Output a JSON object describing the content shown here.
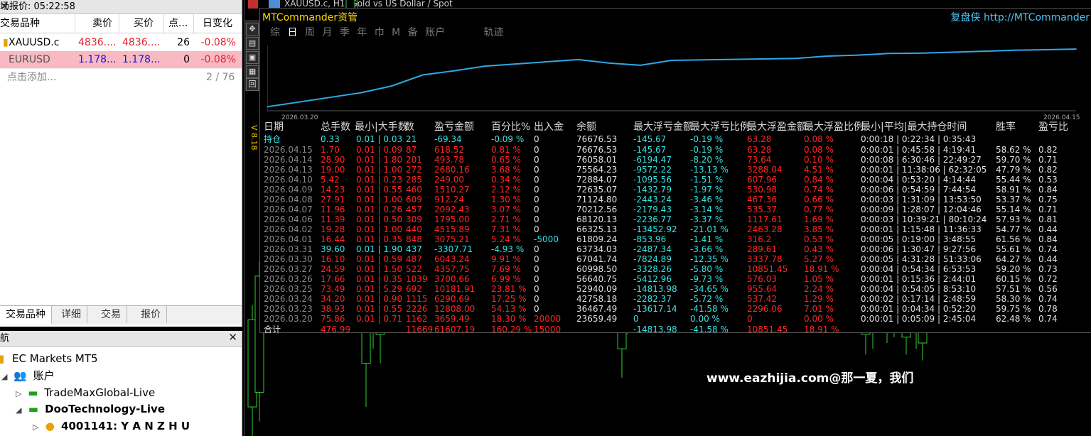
{
  "market_watch": {
    "title": "场报价: 05:22:58",
    "columns": [
      "交易品种",
      "卖价",
      "买价",
      "点...",
      "日变化"
    ],
    "rows": [
      {
        "symbol": "XAUUSD.c",
        "bid": "4836....",
        "ask": "4836....",
        "spread": "26",
        "change": "-0.08%"
      },
      {
        "symbol": "EURUSD",
        "bid": "1.178...",
        "ask": "1.178...",
        "spread": "0",
        "change": "-0.08%"
      }
    ],
    "add_label": "点击添加...",
    "count": "2 / 76",
    "tabs": [
      "交易品种",
      "详细",
      "交易",
      "报价"
    ]
  },
  "navigator": {
    "title": "航",
    "items": [
      "EC Markets MT5",
      "账户",
      "TradeMaxGlobal-Live",
      "DooTechnology-Live",
      "4001141: Y A N Z H U"
    ]
  },
  "chart": {
    "title": "XAUUSD.c, H1:  Gold vs US Dollar / Spot",
    "version": "V 8.18",
    "watermark": "www.eazhijia.com@那一夏，我们",
    "candle_axis_range": [
      0,
      150
    ]
  },
  "overlay": {
    "title": "MTCommander资管",
    "brand": "复盘侠 http://MTCommander",
    "tabs": [
      "综",
      "日",
      "周",
      "月",
      "季",
      "年",
      "巾",
      "M",
      "备",
      "账户",
      "轨迹"
    ],
    "selected_tab": "日",
    "colors": {
      "line": "#2fa8e6",
      "negative": "#ff2525",
      "positive": "#35e3e3"
    }
  },
  "chart_data": {
    "type": "line",
    "x_start_label": "2026.03.20",
    "x_end_label": "2026.04.15",
    "points": [
      {
        "x": "2026.03.20",
        "y": 23659.49
      },
      {
        "x": "2026.03.23",
        "y": 36467.49
      },
      {
        "x": "2026.03.24",
        "y": 42758.18
      },
      {
        "x": "2026.03.25",
        "y": 52940.09
      },
      {
        "x": "2026.03.26",
        "y": 56640.75
      },
      {
        "x": "2026.03.27",
        "y": 60998.5
      },
      {
        "x": "2026.03.30",
        "y": 67041.74
      },
      {
        "x": "2026.03.31",
        "y": 63734.03
      },
      {
        "x": "2026.04.01",
        "y": 61809.24
      },
      {
        "x": "2026.04.02",
        "y": 66325.13
      },
      {
        "x": "2026.04.06",
        "y": 68120.13
      },
      {
        "x": "2026.04.07",
        "y": 70212.56
      },
      {
        "x": "2026.04.08",
        "y": 71124.8
      },
      {
        "x": "2026.04.09",
        "y": 72635.07
      },
      {
        "x": "2026.04.10",
        "y": 72884.07
      },
      {
        "x": "2026.04.13",
        "y": 75564.23
      },
      {
        "x": "2026.04.14",
        "y": 76058.01
      },
      {
        "x": "2026.04.15",
        "y": 76676.53
      }
    ],
    "ylim": [
      20000,
      80000
    ]
  },
  "table": {
    "headers": [
      "日期",
      "总手数",
      "最小|大手数",
      "数",
      "盈亏金额",
      "百分比%",
      "出入金",
      "余额",
      "最大浮亏金额",
      "最大浮亏比例",
      "最大浮盈金额",
      "最大浮盈比例",
      "最小|平均|最大持仓时间",
      "胜率",
      "盈亏比"
    ],
    "holding": {
      "date": "持仓",
      "lots": "0.33",
      "minmax": "0.01 | 0.03",
      "count": "21",
      "pl": "-69.34",
      "pct": "-0.09 %",
      "inout": "0",
      "balance": "76676.53",
      "maxfl": "-145.67",
      "maxflp": "-0.19 %",
      "maxfp": "63.28",
      "maxfpp": "0.08 %",
      "hold": "0:00:18 | 0:22:34 | 0:35:43",
      "win": "",
      "rr": ""
    },
    "rows": [
      {
        "date": "2026.04.15",
        "lots": "1.70",
        "minmax": "0.01 | 0.09",
        "count": "87",
        "pl": "618.52",
        "pct": "0.81 %",
        "inout": "0",
        "balance": "76676.53",
        "maxfl": "-145.67",
        "maxflp": "-0.19 %",
        "maxfp": "63.28",
        "maxfpp": "0.08 %",
        "hold": "0:00:01 | 0:45:58 | 4:19:41",
        "win": "58.62 %",
        "rr": "0.82"
      },
      {
        "date": "2026.04.14",
        "lots": "28.90",
        "minmax": "0.01 | 1.80",
        "count": "201",
        "pl": "493.78",
        "pct": "0.65 %",
        "inout": "0",
        "balance": "76058.01",
        "maxfl": "-6194.47",
        "maxflp": "-8.20 %",
        "maxfp": "73.64",
        "maxfpp": "0.10 %",
        "hold": "0:00:08 | 6:30:46 | 22:49:27",
        "win": "59.70 %",
        "rr": "0.71"
      },
      {
        "date": "2026.04.13",
        "lots": "19.00",
        "minmax": "0.01 | 1.00",
        "count": "272",
        "pl": "2680.16",
        "pct": "3.68 %",
        "inout": "0",
        "balance": "75564.23",
        "maxfl": "-9572.22",
        "maxflp": "-13.13 %",
        "maxfp": "3288.04",
        "maxfpp": "4.51 %",
        "hold": "0:00:01 | 11:38:06 | 62:32:05",
        "win": "47.79 %",
        "rr": "0.82"
      },
      {
        "date": "2026.04.10",
        "lots": "5.42",
        "minmax": "0.01 | 0.23",
        "count": "285",
        "pl": "249.00",
        "pct": "0.34 %",
        "inout": "0",
        "balance": "72884.07",
        "maxfl": "-1095.56",
        "maxflp": "-1.51 %",
        "maxfp": "607.96",
        "maxfpp": "0.84 %",
        "hold": "0:00:04 | 0:53:20 | 4:14:44",
        "win": "55.44 %",
        "rr": "0.53"
      },
      {
        "date": "2026.04.09",
        "lots": "14.23",
        "minmax": "0.01 | 0.55",
        "count": "460",
        "pl": "1510.27",
        "pct": "2.12 %",
        "inout": "0",
        "balance": "72635.07",
        "maxfl": "-1432.79",
        "maxflp": "-1.97 %",
        "maxfp": "530.98",
        "maxfpp": "0.74 %",
        "hold": "0:00:06 | 0:54:59 | 7:44:54",
        "win": "58.91 %",
        "rr": "0.84"
      },
      {
        "date": "2026.04.08",
        "lots": "27.91",
        "minmax": "0.01 | 1.00",
        "count": "609",
        "pl": "912.24",
        "pct": "1.30 %",
        "inout": "0",
        "balance": "71124.80",
        "maxfl": "-2443.24",
        "maxflp": "-3.46 %",
        "maxfp": "467.36",
        "maxfpp": "0.66 %",
        "hold": "0:00:03 | 1:31:09 | 13:53:50",
        "win": "53.37 %",
        "rr": "0.75"
      },
      {
        "date": "2026.04.07",
        "lots": "11.96",
        "minmax": "0.01 | 0.26",
        "count": "457",
        "pl": "2092.43",
        "pct": "3.07 %",
        "inout": "0",
        "balance": "70212.56",
        "maxfl": "-2179.43",
        "maxflp": "-3.14 %",
        "maxfp": "535.37",
        "maxfpp": "0.77 %",
        "hold": "0:00:09 | 1:28:07 | 12:04:46",
        "win": "55.14 %",
        "rr": "0.71"
      },
      {
        "date": "2026.04.06",
        "lots": "11.39",
        "minmax": "0.01 | 0.50",
        "count": "309",
        "pl": "1795.00",
        "pct": "2.71 %",
        "inout": "0",
        "balance": "68120.13",
        "maxfl": "-2236.77",
        "maxflp": "-3.37 %",
        "maxfp": "1117.61",
        "maxfpp": "1.69 %",
        "hold": "0:00:03 | 10:39:21 | 80:10:24",
        "win": "57.93 %",
        "rr": "0.81"
      },
      {
        "date": "2026.04.02",
        "lots": "19.28",
        "minmax": "0.01 | 1.00",
        "count": "440",
        "pl": "4515.89",
        "pct": "7.31 %",
        "inout": "0",
        "balance": "66325.13",
        "maxfl": "-13452.92",
        "maxflp": "-21.01 %",
        "maxfp": "2463.28",
        "maxfpp": "3.85 %",
        "hold": "0:00:01 | 1:15:48 | 11:36:33",
        "win": "54.77 %",
        "rr": "0.44"
      },
      {
        "date": "2026.04.01",
        "lots": "16.44",
        "minmax": "0.01 | 0.35",
        "count": "848",
        "pl": "3075.21",
        "pct": "5.24 %",
        "inout": "-5000",
        "balance": "61809.24",
        "maxfl": "-853.96",
        "maxflp": "-1.41 %",
        "maxfp": "316.2",
        "maxfpp": "0.53 %",
        "hold": "0:00:05 | 0:19:00 | 3:48:55",
        "win": "61.56 %",
        "rr": "0.84"
      },
      {
        "date": "2026.03.31",
        "lots": "39.60",
        "minmax": "0.01 | 1.90",
        "count": "437",
        "pl": "-3307.71",
        "pct": "-4.93 %",
        "inout": "0",
        "balance": "63734.03",
        "maxfl": "-2487.34",
        "maxflp": "-3.66 %",
        "maxfp": "289.61",
        "maxfpp": "0.43 %",
        "hold": "0:00:06 | 1:30:47 | 9:27:56",
        "win": "55.61 %",
        "rr": "0.74"
      },
      {
        "date": "2026.03.30",
        "lots": "16.10",
        "minmax": "0.01 | 0.59",
        "count": "487",
        "pl": "6043.24",
        "pct": "9.91 %",
        "inout": "0",
        "balance": "67041.74",
        "maxfl": "-7824.89",
        "maxflp": "-12.35 %",
        "maxfp": "3337.78",
        "maxfpp": "5.27 %",
        "hold": "0:00:05 | 4:31:28 | 51:33:06",
        "win": "64.27 %",
        "rr": "0.44"
      },
      {
        "date": "2026.03.27",
        "lots": "24.59",
        "minmax": "0.01 | 1.50",
        "count": "522",
        "pl": "4357.75",
        "pct": "7.69 %",
        "inout": "0",
        "balance": "60998.50",
        "maxfl": "-3328.26",
        "maxflp": "-5.80 %",
        "maxfp": "10851.45",
        "maxfpp": "18.91 %",
        "hold": "0:00:04 | 0:54:34 | 6:53:53",
        "win": "59.20 %",
        "rr": "0.73"
      },
      {
        "date": "2026.03.26",
        "lots": "17.66",
        "minmax": "0.01 | 0.35",
        "count": "1039",
        "pl": "3700.66",
        "pct": "6.99 %",
        "inout": "0",
        "balance": "56640.75",
        "maxfl": "-5412.96",
        "maxflp": "-9.73 %",
        "maxfp": "576.03",
        "maxfpp": "1.05 %",
        "hold": "0:00:01 | 0:15:36 | 2:44:01",
        "win": "60.15 %",
        "rr": "0.72"
      },
      {
        "date": "2026.03.25",
        "lots": "73.49",
        "minmax": "0.01 | 5.29",
        "count": "692",
        "pl": "10181.91",
        "pct": "23.81 %",
        "inout": "0",
        "balance": "52940.09",
        "maxfl": "-14813.98",
        "maxflp": "-34.65 %",
        "maxfp": "955.64",
        "maxfpp": "2.24 %",
        "hold": "0:00:04 | 0:54:05 | 8:53:10",
        "win": "57.51 %",
        "rr": "0.56"
      },
      {
        "date": "2026.03.24",
        "lots": "34.20",
        "minmax": "0.01 | 0.90",
        "count": "1115",
        "pl": "6290.69",
        "pct": "17.25 %",
        "inout": "0",
        "balance": "42758.18",
        "maxfl": "-2282.37",
        "maxflp": "-5.72 %",
        "maxfp": "537.42",
        "maxfpp": "1.29 %",
        "hold": "0:00:02 | 0:17:14 | 2:48:59",
        "win": "58.30 %",
        "rr": "0.74"
      },
      {
        "date": "2026.03.23",
        "lots": "38.93",
        "minmax": "0.01 | 0.55",
        "count": "2226",
        "pl": "12808.00",
        "pct": "54.13 %",
        "inout": "0",
        "balance": "36467.49",
        "maxfl": "-13617.14",
        "maxflp": "-41.58 %",
        "maxfp": "2296.06",
        "maxfpp": "7.01 %",
        "hold": "0:00:01 | 0:04:34 | 0:52:20",
        "win": "59.75 %",
        "rr": "0.78"
      },
      {
        "date": "2026.03.20",
        "lots": "75.86",
        "minmax": "0.01 | 0.71",
        "count": "1162",
        "pl": "3659.49",
        "pct": "18.30 %",
        "inout": "20000",
        "balance": "23659.49",
        "maxfl": "0",
        "maxflp": "0.00 %",
        "maxfp": "0",
        "maxfpp": "0.00 %",
        "hold": "0:00:01 | 0:05:09 | 2:45:04",
        "win": "62.48 %",
        "rr": "0.74"
      }
    ],
    "total": {
      "date": "合计",
      "lots": "476.99",
      "count": "11669",
      "pl": "61607.19",
      "pct": "160.29 %",
      "inout": "15000",
      "maxfl": "-14813.98",
      "maxflp": "-41.58 %",
      "maxfp": "10851.45",
      "maxfpp": "18.91 %"
    }
  }
}
